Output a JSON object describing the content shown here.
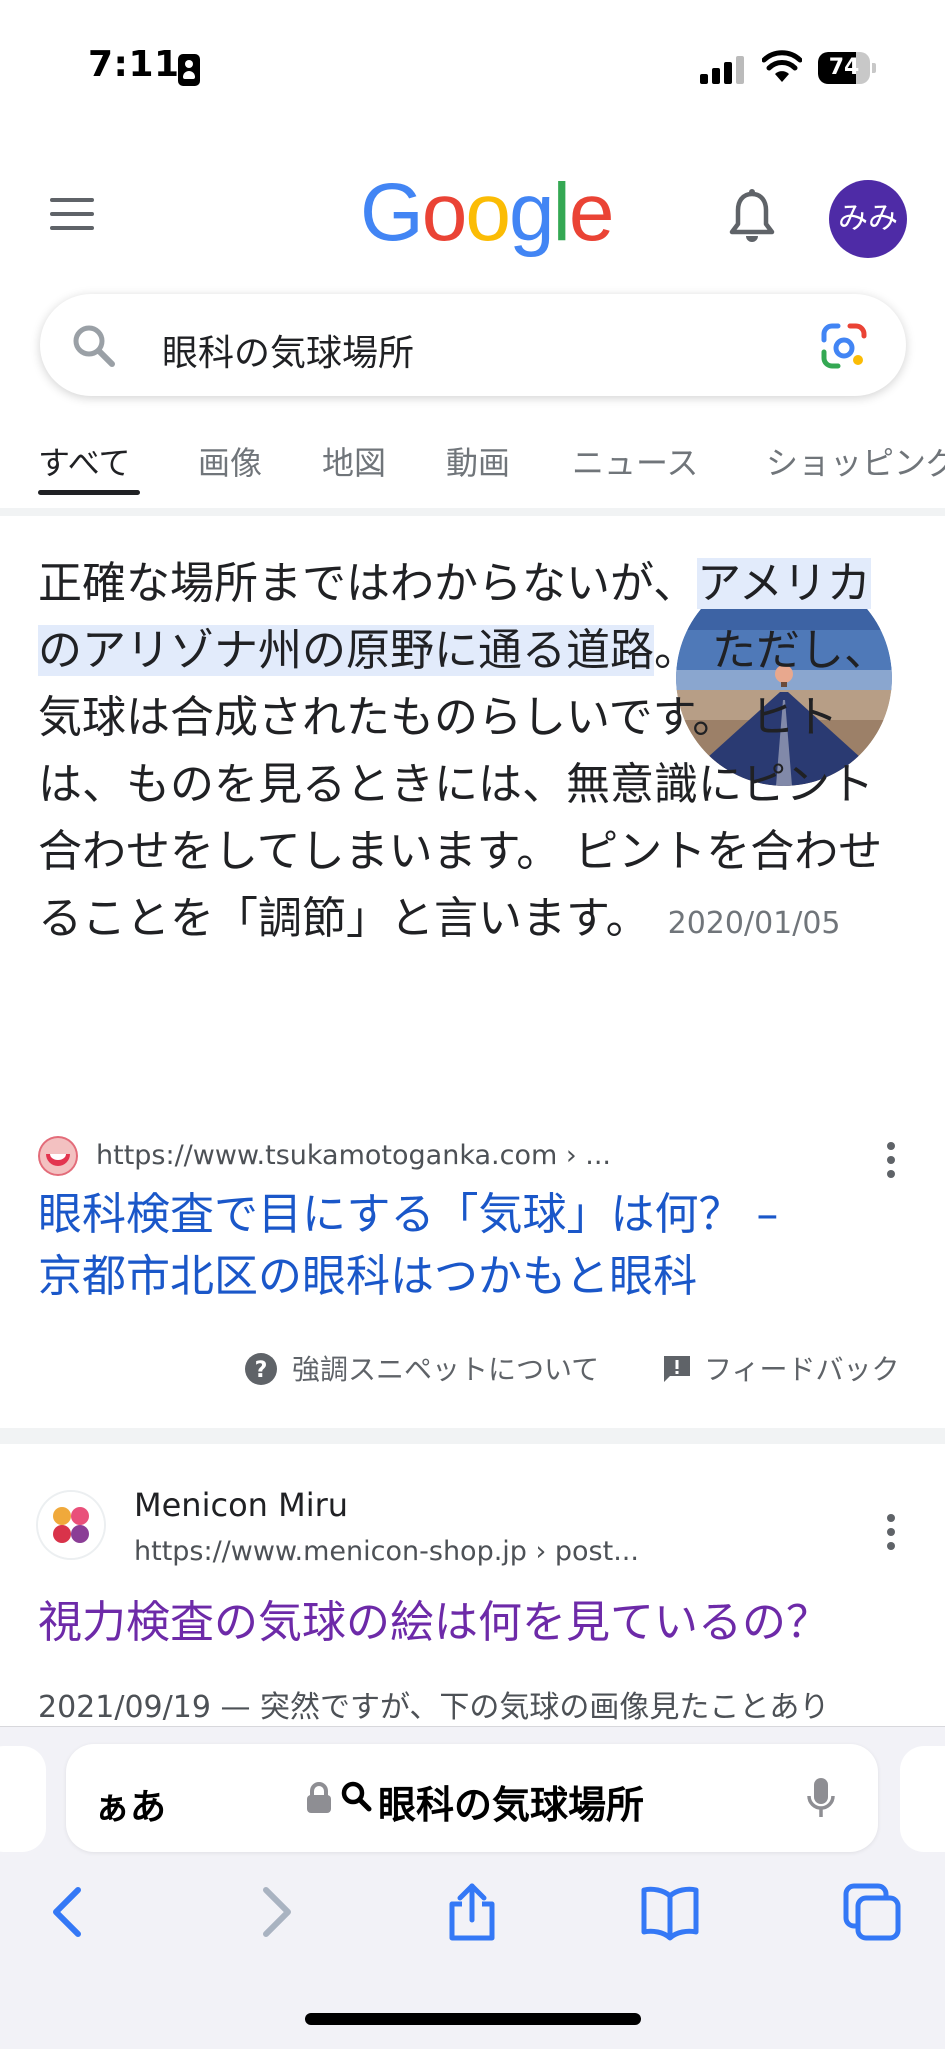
{
  "status_bar": {
    "time": "7:11",
    "battery_level": "74",
    "battery_fraction": 0.74
  },
  "header": {
    "logo_letters": [
      {
        "char": "G",
        "color": "#4285F4"
      },
      {
        "char": "o",
        "color": "#EA4335"
      },
      {
        "char": "o",
        "color": "#FBBC05"
      },
      {
        "char": "g",
        "color": "#4285F4"
      },
      {
        "char": "l",
        "color": "#34A853"
      },
      {
        "char": "e",
        "color": "#EA4335"
      }
    ],
    "avatar_text": "みみ",
    "avatar_color": "#4e2ba6"
  },
  "search": {
    "query": "眼科の気球場所"
  },
  "tabs": [
    {
      "label": "すべて",
      "active": true
    },
    {
      "label": "画像",
      "active": false
    },
    {
      "label": "地図",
      "active": false
    },
    {
      "label": "動画",
      "active": false
    },
    {
      "label": "ニュース",
      "active": false
    },
    {
      "label": "ショッピング",
      "active": false
    }
  ],
  "featured_snippet": {
    "text_before": "正確な場所まではわからないが、",
    "text_highlight": "アメリカのアリゾナ州の原野に通る道路",
    "text_after": "。 ただし、気球は合成されたものらしいです。 ヒトは、ものを見るときには、無意識にピント合わせをしてしまいます。 ピントを合わせることを「調節」と言います。",
    "date": "2020/01/05",
    "source_url": "https://www.tsukamotoganka.com › ...",
    "title_line1": "眼科検査で目にする「気球」は何？ –",
    "title_line2": "京都市北区の眼科はつかもと眼科",
    "about_label": "強調スニペットについて",
    "feedback_label": "フィードバック"
  },
  "result2": {
    "site_name": "Menicon Miru",
    "url": "https://www.menicon-shop.jp › post...",
    "title": "視力検査の気球の絵は何を見ているの？",
    "date": "2021/09/19",
    "snippet": "— 突然ですが、下の気球の画像見たことあり"
  },
  "safari": {
    "aa_label": "ぁあ",
    "address_text": "眼科の気球場所"
  },
  "colors": {
    "link": "#1a57c9",
    "visited_link": "#6d2aa8",
    "highlight": "#e2ebfb",
    "safari_blue": "#3478f6"
  }
}
